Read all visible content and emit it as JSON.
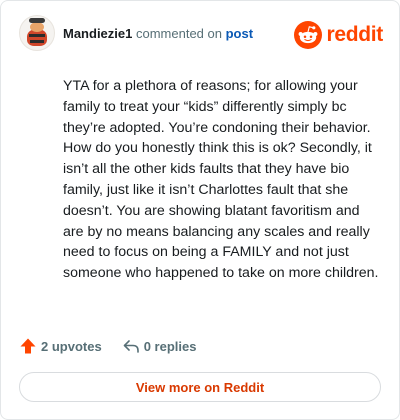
{
  "comment": {
    "username": "Mandiezie1",
    "action_text": "commented on",
    "post_link_label": "post",
    "body": "YTA for a plethora of reasons; for allowing your family to treat your “kids” differently simply bc they’re adopted. You’re condoning their behavior. How do you honestly think this is ok? Secondly, it isn’t all the other kids faults that they have bio family, just like it isn’t Charlottes fault that she doesn’t. You are showing blatant favoritism and are by no means balancing any scales and really need to focus on being a FAMILY and not just someone who happened to take on more children.",
    "upvotes_label": "2 upvotes",
    "replies_label": "0 replies"
  },
  "brand": {
    "wordmark": "reddit",
    "color": "#ff4500"
  },
  "footer": {
    "view_more_label": "View more on Reddit"
  },
  "colors": {
    "upvote_icon": "#ff4500",
    "link": "#0a59b5",
    "view_more_text": "#d93900",
    "muted_text": "#576f76",
    "body_text": "#181c1f"
  },
  "icons": {
    "avatar": "snoo-avatar-icon",
    "brand_logo": "reddit-logo-icon",
    "upvote": "upvote-arrow-icon",
    "reply": "reply-arrow-icon"
  }
}
